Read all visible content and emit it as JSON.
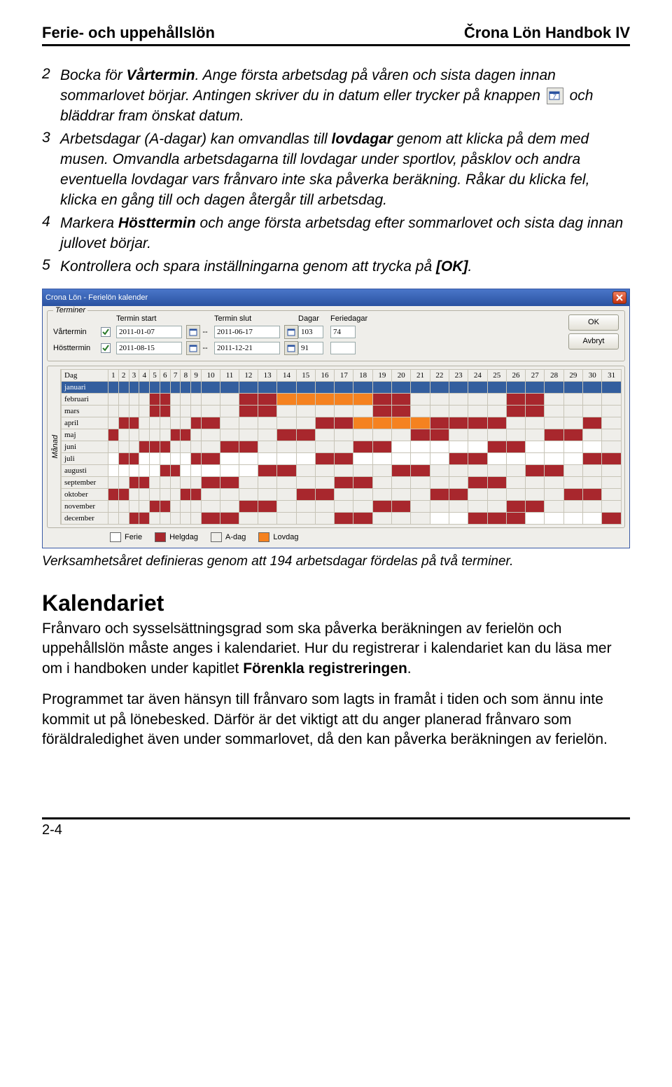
{
  "header": {
    "left": "Ferie- och uppehållslön",
    "right": "Črona Lön Handbok IV"
  },
  "list": [
    {
      "n": "2",
      "pre": "Bocka för ",
      "bold1": "Vårtermin",
      "after1": ". Ange första arbetsdag på våren och sista dagen innan sommarlovet börjar. Antingen skriver du in datum eller trycker på knappen ",
      "after2": " och bläddrar fram önskat datum."
    },
    {
      "n": "3",
      "pre": "Arbetsdagar (A-dagar) kan omvandlas till ",
      "bold1": "lovdagar",
      "after1": " genom att klicka på dem med musen. Omvandla arbetsdagarna till lovdagar under sportlov, påsklov och andra eventuella lovdagar vars frånvaro inte ska påverka beräkning. Råkar du klicka fel, klicka en gång till och dagen återgår till arbetsdag."
    },
    {
      "n": "4",
      "pre": "Markera ",
      "bold1": "Hösttermin",
      "after1": " och ange första arbetsdag efter sommarlovet och sista dag innan jullovet börjar."
    },
    {
      "n": "5",
      "pre": "Kontrollera och spara inställningarna genom att trycka på ",
      "bold1": "[OK]",
      "after1": "."
    }
  ],
  "dialog": {
    "title": "Crona Lön - Ferielön kalender",
    "group_label": "Terminer",
    "headers": {
      "start": "Termin start",
      "slut": "Termin slut",
      "dagar": "Dagar",
      "feriedagar": "Feriedagar"
    },
    "rows": [
      {
        "name": "Vårtermin",
        "start": "2011-01-07",
        "slut": "2011-06-17",
        "dagar": "103",
        "ferie": "74"
      },
      {
        "name": "Hösttermin",
        "start": "2011-08-15",
        "slut": "2011-12-21",
        "dagar": "91",
        "ferie": ""
      }
    ],
    "buttons": {
      "ok": "OK",
      "cancel": "Avbryt"
    },
    "cal": {
      "axis": "Månad",
      "dag": "Dag",
      "nums": [
        "1",
        "2",
        "3",
        "4",
        "5",
        "6",
        "7",
        "8",
        "9",
        "10",
        "11",
        "12",
        "13",
        "14",
        "15",
        "16",
        "17",
        "18",
        "19",
        "20",
        "21",
        "22",
        "23",
        "24",
        "25",
        "26",
        "27",
        "28",
        "29",
        "30",
        "31"
      ],
      "months": [
        "januari",
        "februari",
        "mars",
        "april",
        "maj",
        "juni",
        "juli",
        "augusti",
        "september",
        "oktober",
        "november",
        "december"
      ],
      "legend": {
        "ferie": "Ferie",
        "helg": "Helgdag",
        "adag": "A-dag",
        "lov": "Lovdag"
      }
    }
  },
  "caption": "Verksamhetsåret definieras genom att 194 arbetsdagar fördelas på två terminer.",
  "section": {
    "title": "Kalendariet",
    "p1a": "Frånvaro och sysselsättningsgrad som ska påverka beräkningen av ferielön och uppehållslön måste anges i kalendariet. Hur du registrerar i kalendariet kan du läsa mer om i handboken under kapitlet ",
    "p1b": "Förenkla registreringen",
    "p1c": ".",
    "p2": "Programmet tar även hänsyn till frånvaro som lagts in framåt i tiden och som ännu inte kommit ut på lönebesked. Därför är det viktigt att du anger planerad frånvaro som föräldraledighet även under sommarlovet, då den kan påverka beräkningen av ferielön."
  },
  "footer": "2-4"
}
